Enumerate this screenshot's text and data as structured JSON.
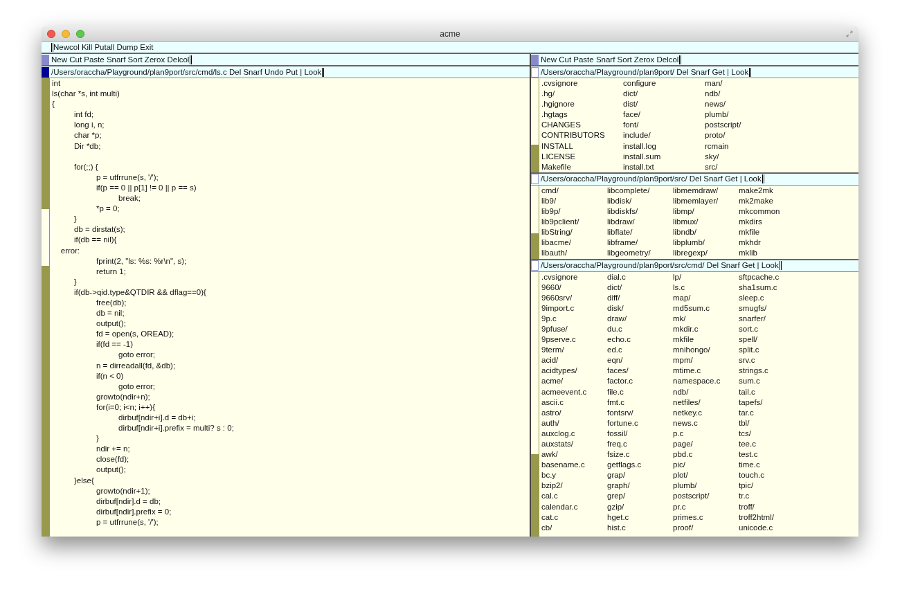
{
  "window": {
    "title": "acme"
  },
  "main_tag": {
    "text": "Newcol Kill Putall Dump Exit"
  },
  "columns": [
    {
      "tag": "New Cut Paste Snarf Sort Zerox Delcol",
      "windows": [
        {
          "kind": "text",
          "tag": "/Users/oraccha/Playground/plan9port/src/cmd/ls.c Del Snarf Undo Put | Look",
          "dirty": true,
          "text": "int\nls(char *s, int multi)\n{\n\tint fd;\n\tlong i, n;\n\tchar *p;\n\tDir *db;\n\n\tfor(;;) {\n\t\tp = utfrrune(s, '/');\n\t\tif(p == 0 || p[1] != 0 || p == s)\n\t\t\tbreak;\n\t\t*p = 0;\n\t}\n\tdb = dirstat(s);\n\tif(db == nil){\n    error:\n\t\tfprint(2, \"ls: %s: %r\\n\", s);\n\t\treturn 1;\n\t}\n\tif(db->qid.type&QTDIR && dflag==0){\n\t\tfree(db);\n\t\tdb = nil;\n\t\toutput();\n\t\tfd = open(s, OREAD);\n\t\tif(fd == -1)\n\t\t\tgoto error;\n\t\tn = dirreadall(fd, &db);\n\t\tif(n < 0)\n\t\t\tgoto error;\n\t\tgrowto(ndir+n);\n\t\tfor(i=0; i<n; i++){\n\t\t\tdirbuf[ndir+i].d = db+i;\n\t\t\tdirbuf[ndir+i].prefix = multi? s : 0;\n\t\t}\n\t\tndir += n;\n\t\tclose(fd);\n\t\toutput();\n\t}else{\n\t\tgrowto(ndir+1);\n\t\tdirbuf[ndir].d = db;\n\t\tdirbuf[ndir].prefix = 0;\n\t\tp = utfrrune(s, '/');"
        }
      ]
    },
    {
      "tag": "New Cut Paste Snarf Sort Zerox Delcol",
      "windows": [
        {
          "kind": "listing",
          "tag": "/Users/oraccha/Playground/plan9port/ Del Snarf Get | Look",
          "dirty": false,
          "columns": [
            [
              ".cvsignore",
              ".hg/",
              ".hgignore",
              ".hgtags",
              "CHANGES",
              "CONTRIBUTORS",
              "INSTALL",
              "LICENSE",
              "Makefile"
            ],
            [
              "configure",
              "dict/",
              "dist/",
              "face/",
              "font/",
              "include/",
              "install.log",
              "install.sum",
              "install.txt"
            ],
            [
              "man/",
              "ndb/",
              "news/",
              "plumb/",
              "postscript/",
              "proto/",
              "rcmain",
              "sky/",
              "src/"
            ]
          ]
        },
        {
          "kind": "listing",
          "tag": "/Users/oraccha/Playground/plan9port/src/ Del Snarf Get | Look",
          "dirty": false,
          "columns": [
            [
              "cmd/",
              "lib9/",
              "lib9p/",
              "lib9pclient/",
              "libString/",
              "libacme/",
              "libauth/"
            ],
            [
              "libcomplete/",
              "libdisk/",
              "libdiskfs/",
              "libdraw/",
              "libflate/",
              "libframe/",
              "libgeometry/"
            ],
            [
              "libmemdraw/",
              "libmemlayer/",
              "libmp/",
              "libmux/",
              "libndb/",
              "libplumb/",
              "libregexp/"
            ],
            [
              "make2mk",
              "mk2make",
              "mkcommon",
              "mkdirs",
              "mkfile",
              "mkhdr",
              "mklib"
            ]
          ]
        },
        {
          "kind": "listing",
          "tag": "/Users/oraccha/Playground/plan9port/src/cmd/ Del Snarf Get | Look",
          "dirty": false,
          "columns": [
            [
              ".cvsignore",
              "9660/",
              "9660srv/",
              "9import.c",
              "9p.c",
              "9pfuse/",
              "9pserve.c",
              "9term/",
              "acid/",
              "acidtypes/",
              "acme/",
              "acmeevent.c",
              "ascii.c",
              "astro/",
              "auth/",
              "auxclog.c",
              "auxstats/",
              "awk/",
              "basename.c",
              "bc.y",
              "bzip2/",
              "cal.c",
              "calendar.c",
              "cat.c",
              "cb/"
            ],
            [
              "dial.c",
              "dict/",
              "diff/",
              "disk/",
              "draw/",
              "du.c",
              "echo.c",
              "ed.c",
              "eqn/",
              "faces/",
              "factor.c",
              "file.c",
              "fmt.c",
              "fontsrv/",
              "fortune.c",
              "fossil/",
              "freq.c",
              "fsize.c",
              "getflags.c",
              "grap/",
              "graph/",
              "grep/",
              "gzip/",
              "hget.c",
              "hist.c"
            ],
            [
              "lp/",
              "ls.c",
              "map/",
              "md5sum.c",
              "mk/",
              "mkdir.c",
              "mkfile",
              "mnihongo/",
              "mpm/",
              "mtime.c",
              "namespace.c",
              "ndb/",
              "netfiles/",
              "netkey.c",
              "news.c",
              "p.c",
              "page/",
              "pbd.c",
              "pic/",
              "plot/",
              "plumb/",
              "postscript/",
              "pr.c",
              "primes.c",
              "proof/"
            ],
            [
              "sftpcache.c",
              "sha1sum.c",
              "sleep.c",
              "smugfs/",
              "snarfer/",
              "sort.c",
              "spell/",
              "split.c",
              "srv.c",
              "strings.c",
              "sum.c",
              "tail.c",
              "tapefs/",
              "tar.c",
              "tbl/",
              "tcs/",
              "tee.c",
              "test.c",
              "time.c",
              "touch.c",
              "tpic/",
              "tr.c",
              "troff/",
              "troff2html/",
              "unicode.c"
            ]
          ]
        }
      ]
    }
  ]
}
